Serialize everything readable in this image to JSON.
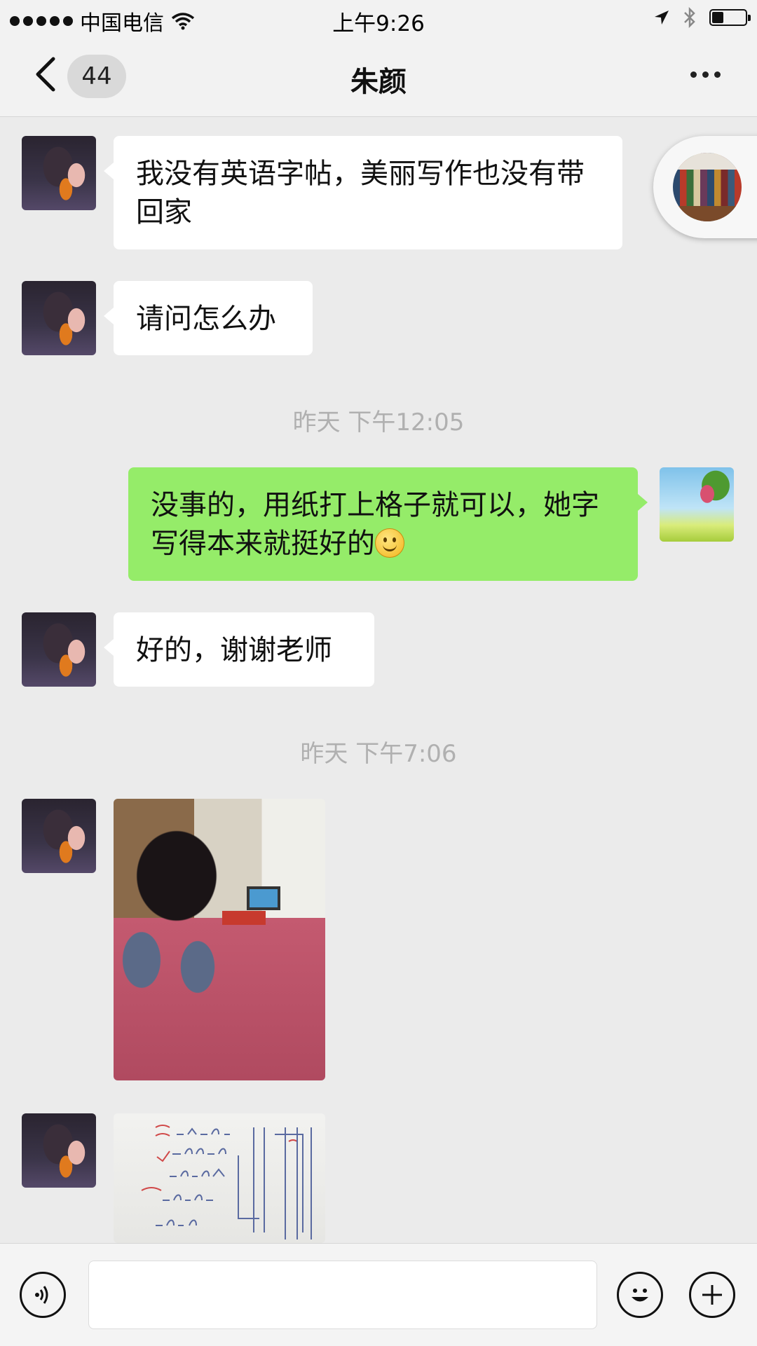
{
  "status_bar": {
    "carrier": "中国电信",
    "time": "上午9:26",
    "battery_level": 0.35
  },
  "nav": {
    "unread_count": "44",
    "title": "朱颜"
  },
  "messages": [
    {
      "sender": "contact",
      "text": "我没有英语字帖，美丽写作也没有带回家"
    },
    {
      "sender": "contact",
      "text": "请问怎么办"
    },
    {
      "type": "timestamp",
      "text": "昨天 下午12:05"
    },
    {
      "sender": "me",
      "text": "没事的，用纸打上格子就可以，她字写得本来就挺好的",
      "emoji": "smile-emoji"
    },
    {
      "sender": "contact",
      "text": "好的，谢谢老师"
    },
    {
      "type": "timestamp",
      "text": "昨天 下午7:06"
    },
    {
      "sender": "contact",
      "type": "image",
      "image": "child-doing-homework-photo"
    },
    {
      "sender": "contact",
      "type": "image",
      "image": "homework-answers-photo"
    }
  ],
  "icons": {
    "back": "chevron-left-icon",
    "more": "more-dots-icon",
    "voice": "voice-icon",
    "emoji": "emoji-icon",
    "plus": "plus-icon"
  },
  "colors": {
    "outgoing_bubble": "#95ec69",
    "incoming_bubble": "#ffffff",
    "background": "#ebebeb"
  }
}
